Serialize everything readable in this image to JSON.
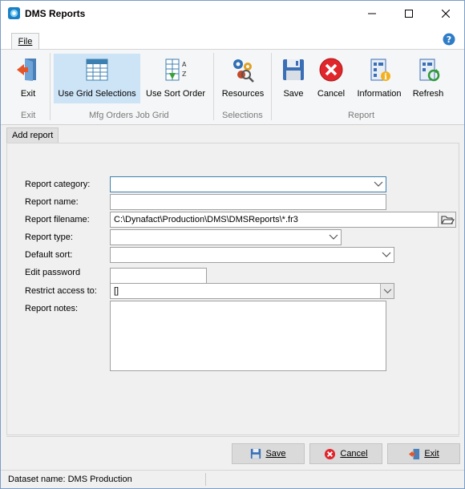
{
  "window": {
    "title": "DMS Reports"
  },
  "ribbon": {
    "file_tab": "File",
    "buttons": [
      {
        "label": "Exit",
        "icon": "exit-door-icon"
      },
      {
        "label": "Use Grid Selections",
        "icon": "grid-icon",
        "active": true
      },
      {
        "label": "Use Sort Order",
        "icon": "sort-az-icon"
      },
      {
        "label": "Resources",
        "icon": "resources-gears-icon"
      },
      {
        "label": "Save",
        "icon": "floppy-save-icon"
      },
      {
        "label": "Cancel",
        "icon": "cancel-x-icon"
      },
      {
        "label": "Information",
        "icon": "information-icon"
      },
      {
        "label": "Refresh",
        "icon": "refresh-icon"
      }
    ],
    "groups": {
      "exit": "Exit",
      "grid": "Mfg Orders Job Grid",
      "selections": "Selections",
      "report": "Report"
    }
  },
  "page_tab": "Add report",
  "form": {
    "report_category_label": "Report category:",
    "report_category_value": "",
    "report_name_label": "Report name:",
    "report_name_value": "",
    "report_filename_label": "Report filename:",
    "report_filename_value": "C:\\Dynafact\\Production\\DMS\\DMSReports\\*.fr3",
    "report_type_label": "Report type:",
    "report_type_value": "",
    "default_sort_label": "Default sort:",
    "default_sort_value": "",
    "edit_password_label": "Edit password",
    "edit_password_value": "",
    "restrict_access_label": "Restrict access to:",
    "restrict_access_value": "[]",
    "report_notes_label": "Report notes:",
    "report_notes_value": ""
  },
  "footer": {
    "save_label": "Save",
    "cancel_label": "Cancel",
    "exit_label": "Exit"
  },
  "status": {
    "dataset_text": "Dataset name:  DMS Production"
  },
  "colors": {
    "accent": "#3c7fb1",
    "active_button": "#cde4f7",
    "cancel_red": "#e0262c"
  }
}
